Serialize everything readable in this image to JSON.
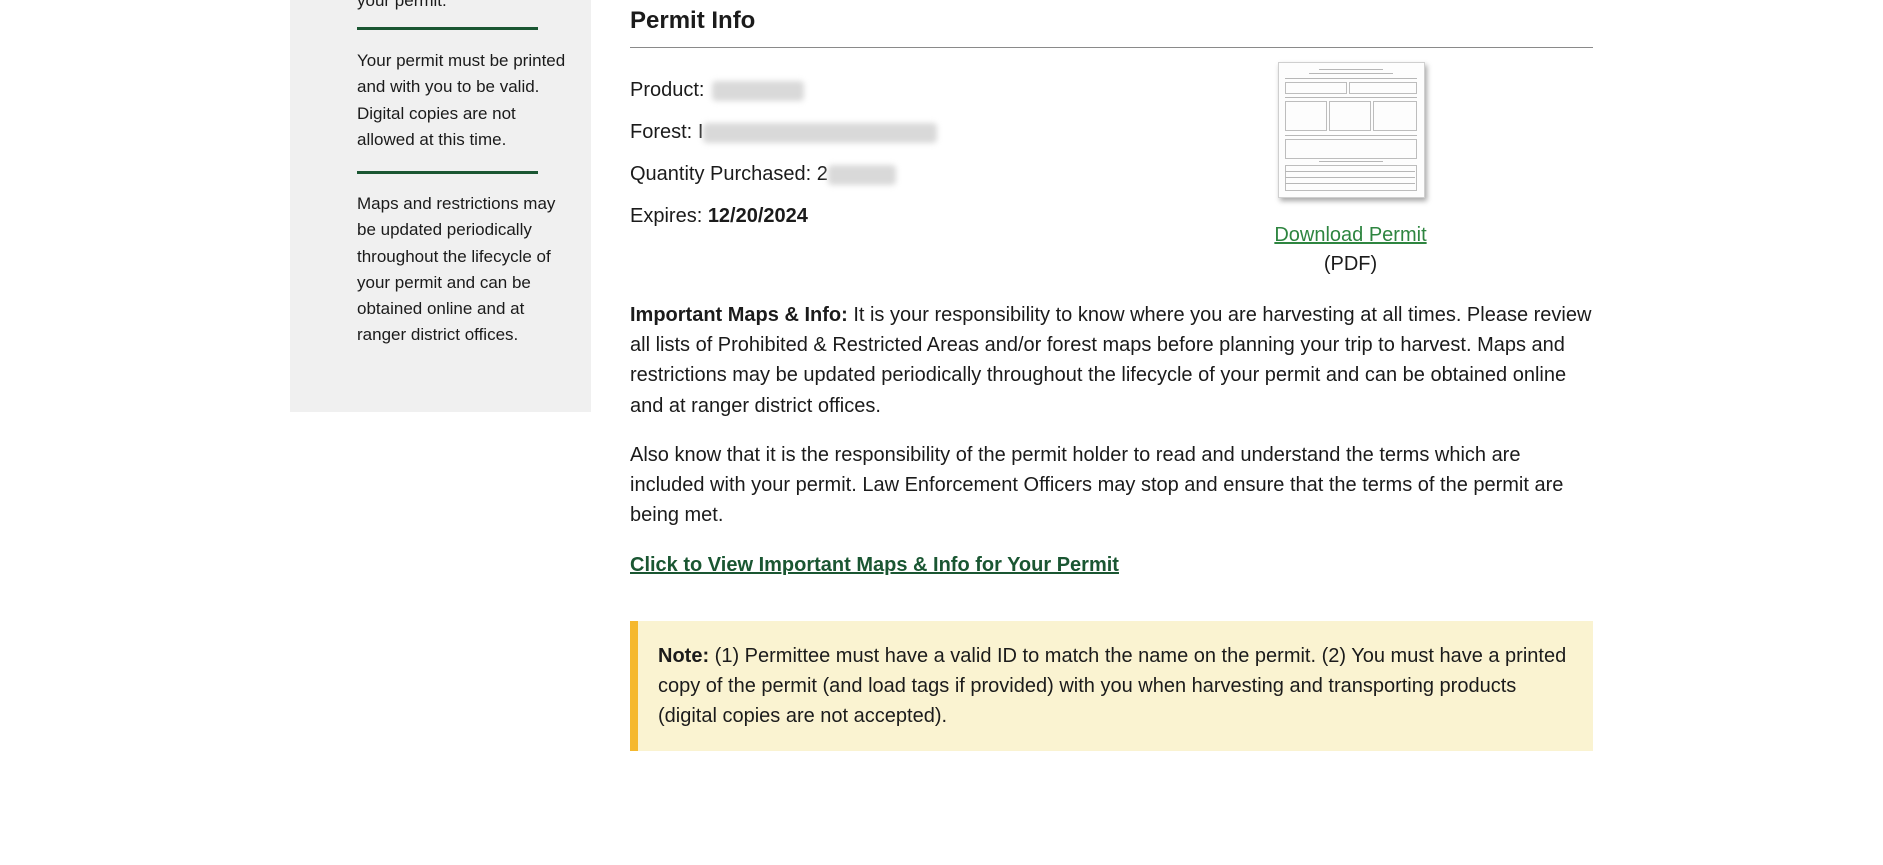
{
  "sidebar": {
    "cut_text": "your permit.",
    "block1": "Your permit must be printed and with you to be valid. Digital copies are not allowed at this time.",
    "block2": "Maps and restrictions may be updated periodically throughout the lifecycle of your permit and can be obtained online and at ranger district offices."
  },
  "permit_info": {
    "title": "Permit Info",
    "product_label": "Product:",
    "forest_label": "Forest:",
    "forest_value_prefix": "I",
    "quantity_label": "Quantity Purchased:",
    "quantity_value_prefix": "2",
    "expires_label": "Expires:",
    "expires_value": "12/20/2024",
    "download_link": "Download Permit",
    "download_format": "(PDF)"
  },
  "important": {
    "heading": "Important Maps & Info:",
    "text": " It is your responsibility to know where you are harvesting at all times. Please review all lists of Prohibited & Restricted Areas and/or forest maps before planning your trip to harvest. Maps and restrictions may be updated periodically throughout the lifecycle of your permit and can be obtained online and at ranger district offices.",
    "also_text": "Also know that it is the responsibility of the permit holder to read and understand the terms which are included with your permit. Law Enforcement Officers may stop and ensure that the terms of the permit are being met.",
    "maps_link": "Click to View Important Maps & Info for Your Permit"
  },
  "note": {
    "label": "Note:",
    "text": " (1) Permittee must have a valid ID to match the name on the permit. (2) You must have a printed copy of the permit (and load tags if provided) with you when harvesting and transporting products (digital copies are not accepted)."
  },
  "colors": {
    "link_green": "#2e8540",
    "dark_green": "#1a5632",
    "note_bg": "#faf3d1",
    "note_border": "#f5b82e",
    "sidebar_bg": "#f0f0f0"
  }
}
